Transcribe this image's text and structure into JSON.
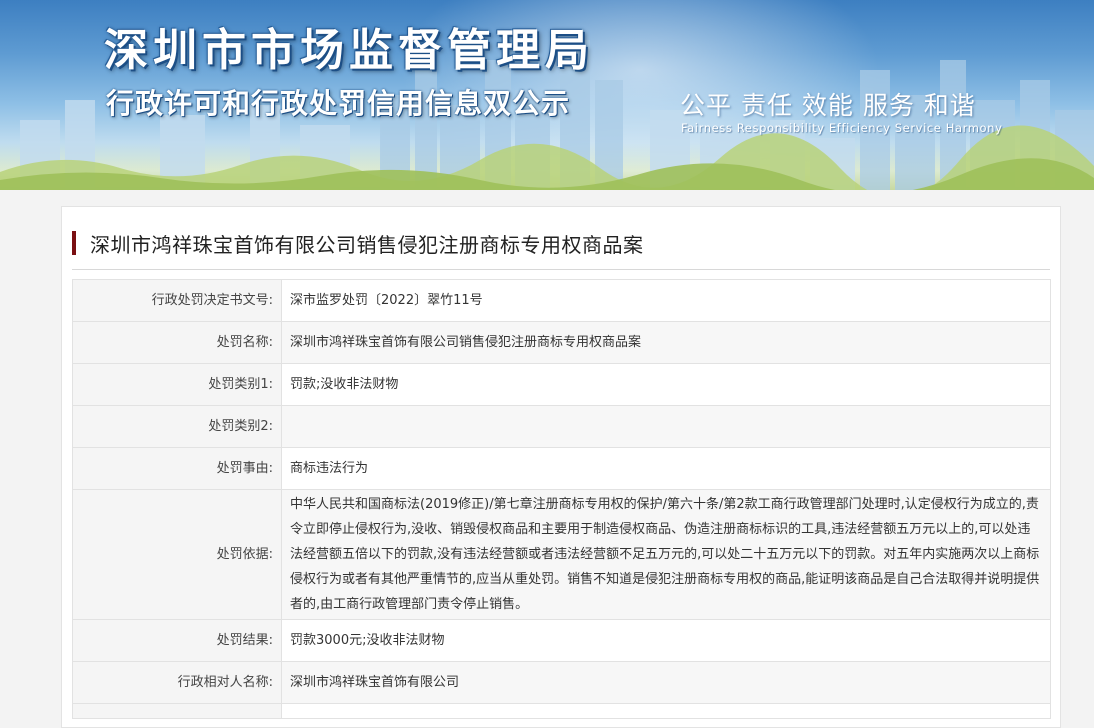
{
  "banner": {
    "title": "深圳市市场监督管理局",
    "subtitle": "行政许可和行政处罚信用信息双公示",
    "motto": "公平 责任 效能 服务 和谐",
    "motto_en": "Fairness Responsibility Efficiency Service Harmony"
  },
  "case": {
    "title": "深圳市鸿祥珠宝首饰有限公司销售侵犯注册商标专用权商品案"
  },
  "fields": [
    {
      "label": "行政处罚决定书文号:",
      "value": "深市监罗处罚〔2022〕翠竹11号"
    },
    {
      "label": "处罚名称:",
      "value": "深圳市鸿祥珠宝首饰有限公司销售侵犯注册商标专用权商品案"
    },
    {
      "label": "处罚类别1:",
      "value": "罚款;没收非法财物"
    },
    {
      "label": "处罚类别2:",
      "value": ""
    },
    {
      "label": "处罚事由:",
      "value": "商标违法行为"
    },
    {
      "label": "处罚依据:",
      "value": "中华人民共和国商标法(2019修正)/第七章注册商标专用权的保护/第六十条/第2款工商行政管理部门处理时,认定侵权行为成立的,责令立即停止侵权行为,没收、销毁侵权商品和主要用于制造侵权商品、伪造注册商标标识的工具,违法经营额五万元以上的,可以处违法经营额五倍以下的罚款,没有违法经营额或者违法经营额不足五万元的,可以处二十五万元以下的罚款。对五年内实施两次以上商标侵权行为或者有其他严重情节的,应当从重处罚。销售不知道是侵犯注册商标专用权的商品,能证明该商品是自己合法取得并说明提供者的,由工商行政管理部门责令停止销售。"
    },
    {
      "label": "处罚结果:",
      "value": "罚款3000元;没收非法财物"
    },
    {
      "label": "行政相对人名称:",
      "value": "深圳市鸿祥珠宝首饰有限公司"
    }
  ]
}
